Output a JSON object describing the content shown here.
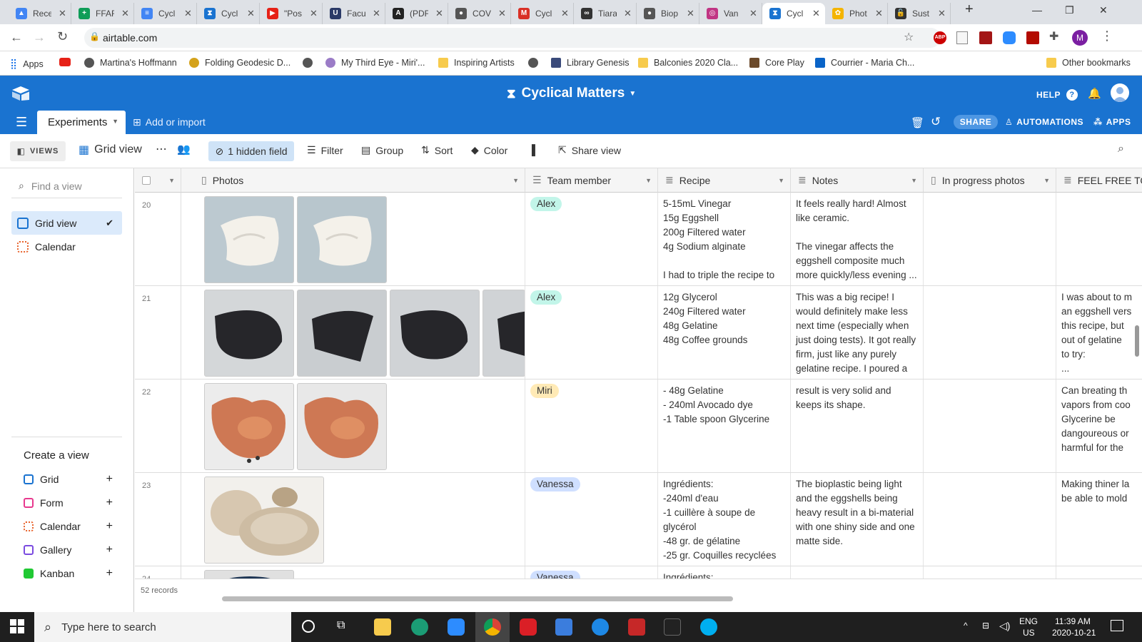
{
  "browser": {
    "tabs": [
      {
        "label": "Rece",
        "color": "#4285f4",
        "glyph": "▲"
      },
      {
        "label": "FFAF",
        "color": "#0f9d58",
        "glyph": "+"
      },
      {
        "label": "Cycl",
        "color": "#4285f4",
        "glyph": "≡"
      },
      {
        "label": "Cycl",
        "color": "#1a73d0",
        "glyph": "⧗"
      },
      {
        "label": "\"Pos",
        "color": "#e62117",
        "glyph": "▶"
      },
      {
        "label": "Facu",
        "color": "#2b3a67",
        "glyph": "U"
      },
      {
        "label": "(PDF",
        "color": "#222222",
        "glyph": "A"
      },
      {
        "label": "COV",
        "color": "#555555",
        "glyph": "●"
      },
      {
        "label": "Cycl",
        "color": "#d93025",
        "glyph": "M"
      },
      {
        "label": "Tiara",
        "color": "#333333",
        "glyph": "∞"
      },
      {
        "label": "Biop",
        "color": "#555555",
        "glyph": "●"
      },
      {
        "label": "Van",
        "color": "#c13584",
        "glyph": "◎"
      },
      {
        "label": "Cycl",
        "color": "#1a73d0",
        "glyph": "⧗"
      },
      {
        "label": "Phot",
        "color": "#f4b400",
        "glyph": "✿"
      },
      {
        "label": "Sust",
        "color": "#333333",
        "glyph": "🔓"
      }
    ],
    "active_tab": 12,
    "url": "airtable.com",
    "bookmarks": [
      "Apps",
      "",
      "Martina's Hoffmann",
      "Folding Geodesic D...",
      "",
      "My Third Eye - Miri'...",
      "Inspiring Artists",
      "",
      "Library Genesis",
      "Balconies 2020 Cla...",
      "Core Play",
      "Courrier - Maria Ch...",
      "Other bookmarks"
    ],
    "profile_initial": "M"
  },
  "header": {
    "title": "Cyclical Matters",
    "help": "HELP",
    "table_tab": "Experiments",
    "add_import": "Add or import",
    "share": "SHARE",
    "automations": "AUTOMATIONS",
    "apps": "APPS"
  },
  "toolbar": {
    "views": "VIEWS",
    "current_view": "Grid view",
    "hidden": "1 hidden field",
    "filter": "Filter",
    "group": "Group",
    "sort": "Sort",
    "color": "Color",
    "share_view": "Share view"
  },
  "sidebar": {
    "find_placeholder": "Find a view",
    "views": [
      {
        "label": "Grid view",
        "color": "#1a73d0"
      },
      {
        "label": "Calendar",
        "color": "#e8622b"
      }
    ],
    "create_title": "Create a view",
    "create_items": [
      {
        "label": "Grid",
        "color": "#1a73d0"
      },
      {
        "label": "Form",
        "color": "#e8398e"
      },
      {
        "label": "Calendar",
        "color": "#e8622b"
      },
      {
        "label": "Gallery",
        "color": "#7b4be0"
      },
      {
        "label": "Kanban",
        "color": "#20c933"
      }
    ]
  },
  "grid": {
    "columns": [
      "Photos",
      "Team member",
      "Recipe",
      "Notes",
      "In progress photos",
      "FEEL FREE TO"
    ],
    "rows": [
      {
        "num": "20",
        "photos": [
          "#bcc9d0",
          "#b8c6cd"
        ],
        "photo_kind": "white",
        "member": "Alex",
        "member_color": "#c2f5e9",
        "recipe": "5-15mL Vinegar\n15g Eggshell\n200g Filtered water\n4g Sodium alginate\n\nI had to triple the recipe to ...",
        "notes": "It feels really hard! Almost like ceramic.\n\nThe vinegar affects the eggshell composite much more quickly/less evening ...",
        "feel": ""
      },
      {
        "num": "21",
        "photos": [
          "#d4d7d9",
          "#c9cdd0",
          "#d0d3d6",
          "#d0d3d6"
        ],
        "photo_kind": "black",
        "member": "Alex",
        "member_color": "#c2f5e9",
        "recipe": "12g Glycerol\n240g Filtered water\n48g Gelatine\n48g Coffee grounds",
        "notes": "This was a big recipe! I would definitely make less next time (especially when just doing tests). It got really firm, just like any purely gelatine recipe. I poured a ...",
        "feel": "I was about to m\nan eggshell vers\nthis recipe, but\nout of gelatine\nto try:\n..."
      },
      {
        "num": "22",
        "photos": [
          "#ececec",
          "#e8e8e8"
        ],
        "photo_kind": "amber",
        "member": "Miri",
        "member_color": "#ffeab6",
        "recipe": "- 48g Gelatine\n- 240ml Avocado dye\n-1 Table spoon Glycerine",
        "notes": "result is very solid and keeps its shape.",
        "feel": "Can breating th\nvapors from coo\nGlycerine be\ndangoureous or\nharmful for the"
      },
      {
        "num": "23",
        "photos": [
          "#f2f0ec"
        ],
        "photo_kind": "speckled",
        "member": "Vanessa",
        "member_color": "#cfdfff",
        "recipe": "Ingrédients:\n-240ml d'eau\n-1 cuillère à soupe de glycérol\n-48 gr. de gélatine\n-25 gr. Coquilles recyclées ...",
        "notes": "The bioplastic being light and the eggshells being heavy result in a bi-material with one shiny side and one matte side.",
        "feel": "Making thiner la\nbe able to mold"
      },
      {
        "num": "24",
        "photos": [
          "#e0e0e0"
        ],
        "photo_kind": "partial",
        "member": "Vanessa",
        "member_color": "#cfdfff",
        "recipe": "Ingrédients:",
        "notes": "",
        "feel": ""
      }
    ],
    "record_count": "52 records"
  },
  "taskbar": {
    "search_placeholder": "Type here to search",
    "lang": "ENG",
    "region": "US",
    "time": "11:39 AM",
    "date": "2020-10-21"
  }
}
